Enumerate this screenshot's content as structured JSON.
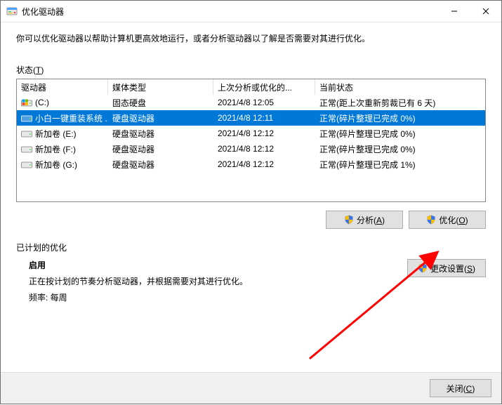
{
  "titlebar": {
    "title": "优化驱动器"
  },
  "intro": "你可以优化驱动器以帮助计算机更高效地运行，或者分析驱动器以了解是否需要对其进行优化。",
  "status_label": "状态(",
  "status_label_ul": "T",
  "status_label_after": ")",
  "columns": {
    "drive": "驱动器",
    "media": "媒体类型",
    "last": "上次分析或优化的...",
    "status": "当前状态"
  },
  "drives": [
    {
      "name": "(C:)",
      "media": "固态硬盘",
      "last": "2021/4/8 12:05",
      "status": "正常(距上次重新剪裁已有 6 天)",
      "selected": false,
      "os": true
    },
    {
      "name": "小白一键重装系统 ...",
      "media": "硬盘驱动器",
      "last": "2021/4/8 12:11",
      "status": "正常(碎片整理已完成 0%)",
      "selected": true,
      "os": false
    },
    {
      "name": "新加卷 (E:)",
      "media": "硬盘驱动器",
      "last": "2021/4/8 12:12",
      "status": "正常(碎片整理已完成 0%)",
      "selected": false,
      "os": false
    },
    {
      "name": "新加卷 (F:)",
      "media": "硬盘驱动器",
      "last": "2021/4/8 12:12",
      "status": "正常(碎片整理已完成 0%)",
      "selected": false,
      "os": false
    },
    {
      "name": "新加卷 (G:)",
      "media": "硬盘驱动器",
      "last": "2021/4/8 12:12",
      "status": "正常(碎片整理已完成 1%)",
      "selected": false,
      "os": false
    }
  ],
  "buttons": {
    "analyze_pre": "分析(",
    "analyze_ul": "A",
    "analyze_post": ")",
    "optimize_pre": "优化(",
    "optimize_ul": "O",
    "optimize_post": ")",
    "change_pre": "更改设置(",
    "change_ul": "S",
    "change_post": ")",
    "close_pre": "关闭(",
    "close_ul": "C",
    "close_post": ")"
  },
  "scheduled": {
    "label": "已计划的优化",
    "enabled": "启用",
    "desc": "正在按计划的节奏分析驱动器，并根据需要对其进行优化。",
    "freq": "频率: 每周"
  }
}
